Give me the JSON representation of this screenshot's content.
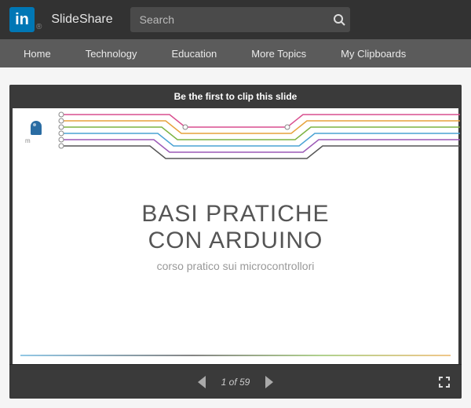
{
  "header": {
    "logo_text": "in",
    "brand": "SlideShare",
    "registered": "®",
    "search_placeholder": "Search"
  },
  "nav": {
    "items": [
      "Home",
      "Technology",
      "Education",
      "More Topics",
      "My Clipboards"
    ]
  },
  "viewer": {
    "clip_banner": "Be the first to clip this slide",
    "slide": {
      "title_line1": "BASI PRATICHE",
      "title_line2": "CON ARDUINO",
      "subtitle": "corso pratico sui microcontrollori",
      "logo_label": "m"
    },
    "controls": {
      "current_page": 1,
      "total_pages": 59,
      "page_label": "1 of 59"
    }
  },
  "colors": {
    "linkedin_blue": "#0077b5",
    "dark_bg": "#323232",
    "nav_bg": "#5b5b5b",
    "viewer_bg": "#3a3a3a"
  }
}
